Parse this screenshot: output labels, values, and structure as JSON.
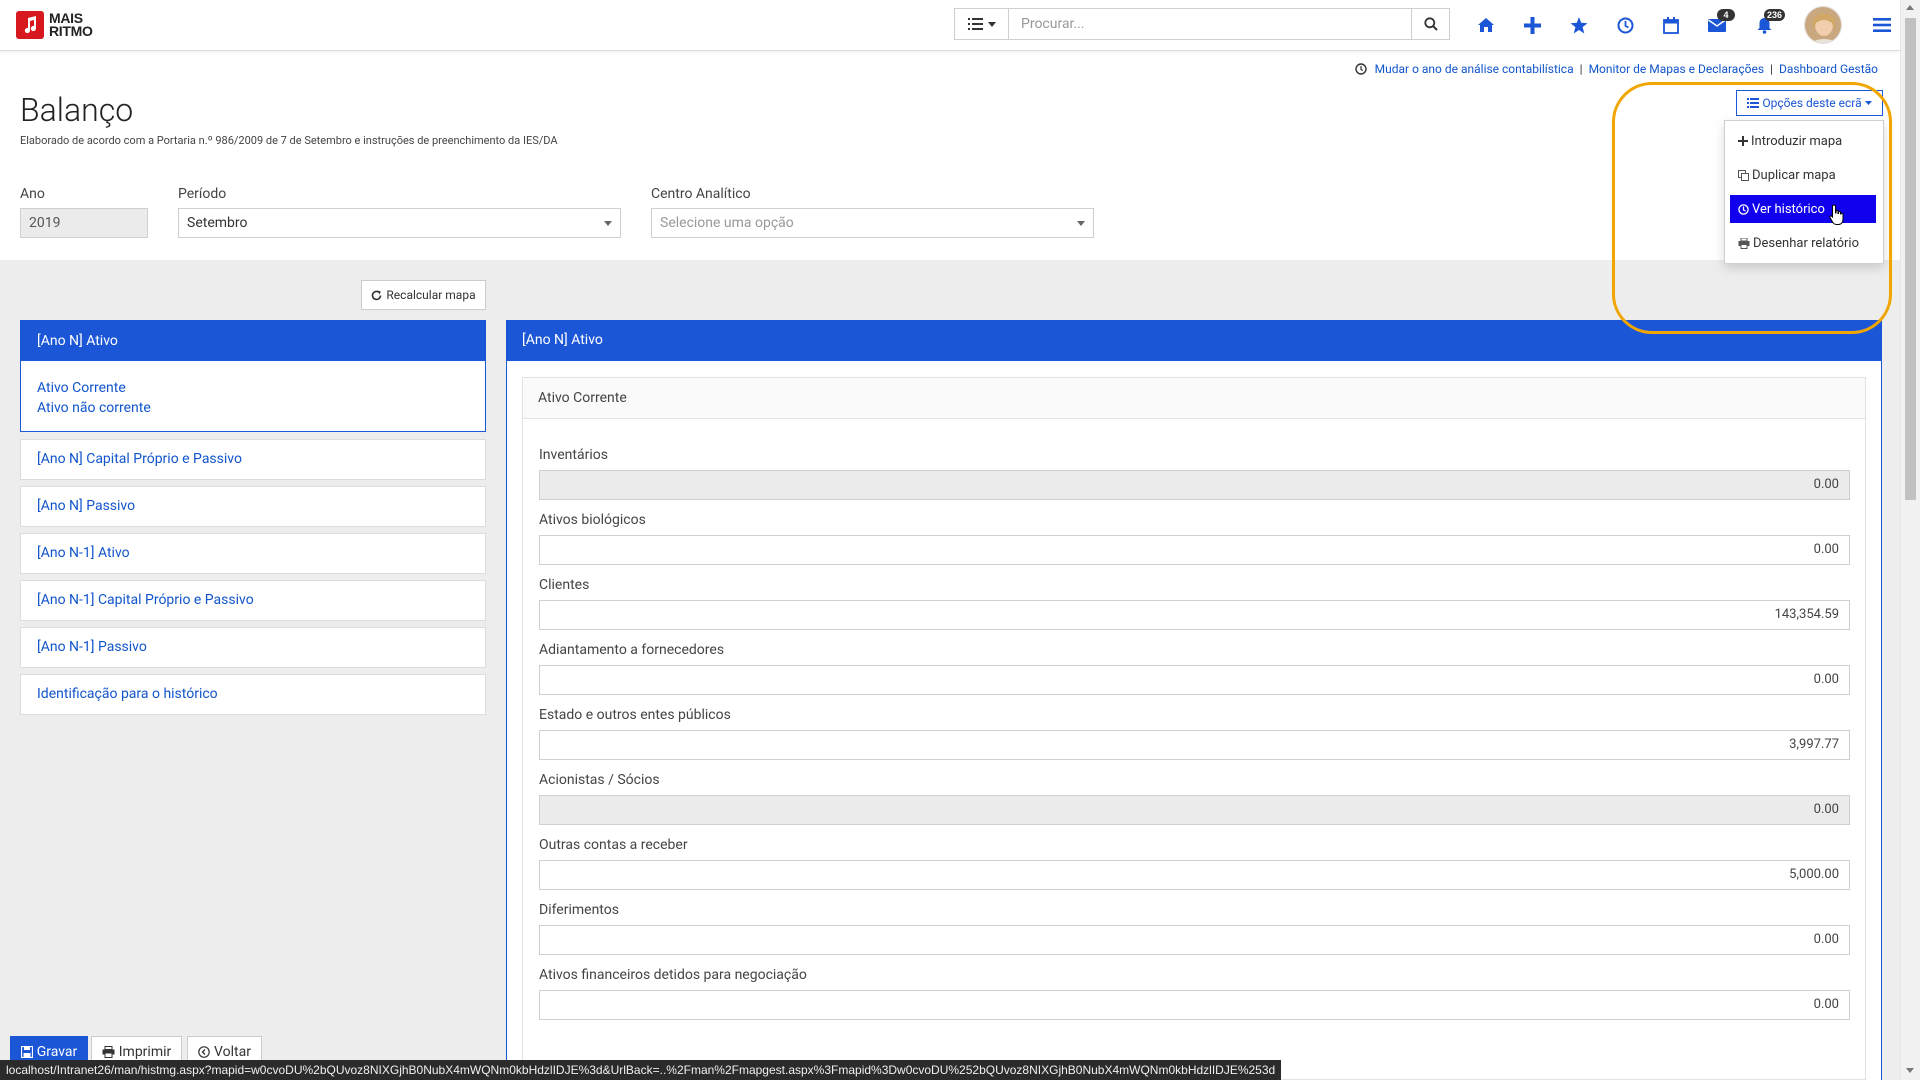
{
  "brand": {
    "line1": "MAIS",
    "line2": "RITMO"
  },
  "search": {
    "placeholder": "Procurar..."
  },
  "nav": {
    "messages_badge": "4",
    "notifications_badge": "236"
  },
  "top_links": [
    "Mudar o ano de análise contabilística",
    "Monitor de Mapas e Declarações",
    "Dashboard Gestão"
  ],
  "page": {
    "title": "Balanço",
    "subtitle": "Elaborado de acordo com a Portaria n.º 986/2009 de 7 de Setembro e instruções de preenchimento da IES/DA"
  },
  "filters": {
    "ano_label": "Ano",
    "ano_value": "2019",
    "periodo_label": "Período",
    "periodo_value": "Setembro",
    "centro_label": "Centro Analítico",
    "centro_placeholder": "Selecione uma opção"
  },
  "options_menu": {
    "button_label": "Opções deste ecrã",
    "items": [
      "Introduzir mapa",
      "Duplicar mapa",
      "Ver histórico",
      "Desenhar relatório"
    ],
    "active_index": 2
  },
  "recalc_label": "Recalcular mapa",
  "left_panel": {
    "active_header": "[Ano N] Ativo",
    "active_links": [
      "Ativo Corrente",
      "Ativo não corrente"
    ],
    "items": [
      "[Ano N] Capital Próprio e Passivo",
      "[Ano N] Passivo",
      "[Ano N-1] Ativo",
      "[Ano N-1] Capital Próprio e Passivo",
      "[Ano N-1] Passivo",
      "Identificação para o histórico"
    ]
  },
  "right_panel": {
    "header": "[Ano N] Ativo",
    "section_title": "Ativo Corrente",
    "fields": [
      {
        "label": "Inventários",
        "value": "0.00",
        "readonly": true
      },
      {
        "label": "Ativos biológicos",
        "value": "0.00",
        "readonly": false
      },
      {
        "label": "Clientes",
        "value": "143,354.59",
        "readonly": false
      },
      {
        "label": "Adiantamento a fornecedores",
        "value": "0.00",
        "readonly": false
      },
      {
        "label": "Estado e outros entes públicos",
        "value": "3,997.77",
        "readonly": false
      },
      {
        "label": "Acionistas / Sócios",
        "value": "0.00",
        "readonly": true
      },
      {
        "label": "Outras contas a receber",
        "value": "5,000.00",
        "readonly": false
      },
      {
        "label": "Diferimentos",
        "value": "0.00",
        "readonly": false
      },
      {
        "label": "Ativos financeiros detidos para negociação",
        "value": "0.00",
        "readonly": false
      }
    ]
  },
  "bottom": {
    "save_label": "Gravar",
    "print_label": "Imprimir",
    "back_label": "Voltar",
    "status_url": "localhost/Intranet26/man/histmg.aspx?mapid=w0cvoDU%2bQUvoz8NIXGjhB0NubX4mWQNm0kbHdzlIDJE%3d&UrlBack=..%2Fman%2Fmapgest.aspx%3Fmapid%3Dw0cvoDU%252bQUvoz8NIXGjhB0NubX4mWQNm0kbHdzlIDJE%253d"
  },
  "colors": {
    "primary": "#1a56d6",
    "active_menu": "#1100ee",
    "highlight": "#f0a500",
    "brand_red": "#d7191f"
  }
}
